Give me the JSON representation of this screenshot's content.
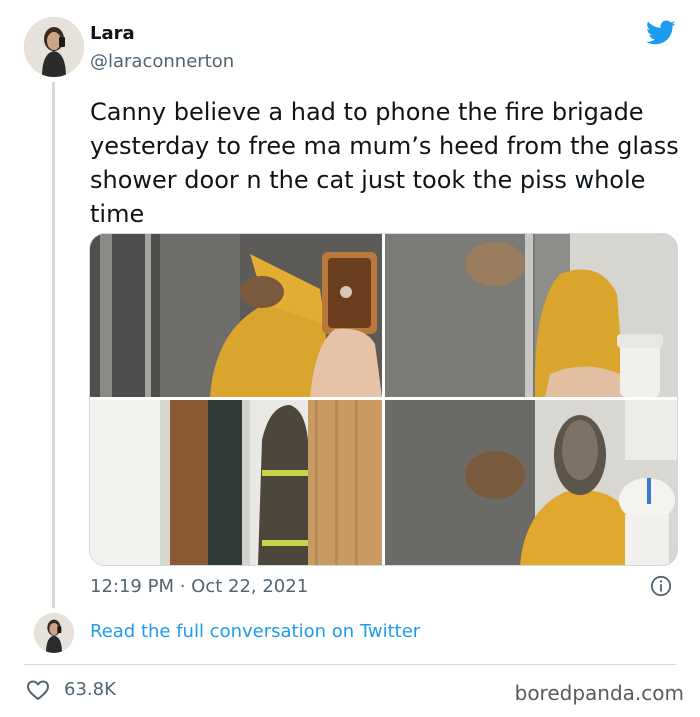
{
  "user": {
    "name": "Lara",
    "handle": "@laraconnerton"
  },
  "tweet": {
    "text": "Canny believe a had to phone the fire brigade yesterday to free ma mum’s heed from the glass shower door n the cat just took the piss whole time",
    "timestamp": "12:19 PM · Oct 22, 2021",
    "read_more": "Read the full conversation on Twitter",
    "likes": "63.8K"
  },
  "icons": {
    "brand": "twitter-bird-icon",
    "info": "info-icon",
    "like": "heart-icon"
  },
  "colors": {
    "link": "#1d9bf0",
    "brand": "#1d9bf0",
    "muted": "#536471"
  },
  "watermark": "boredpanda.com"
}
